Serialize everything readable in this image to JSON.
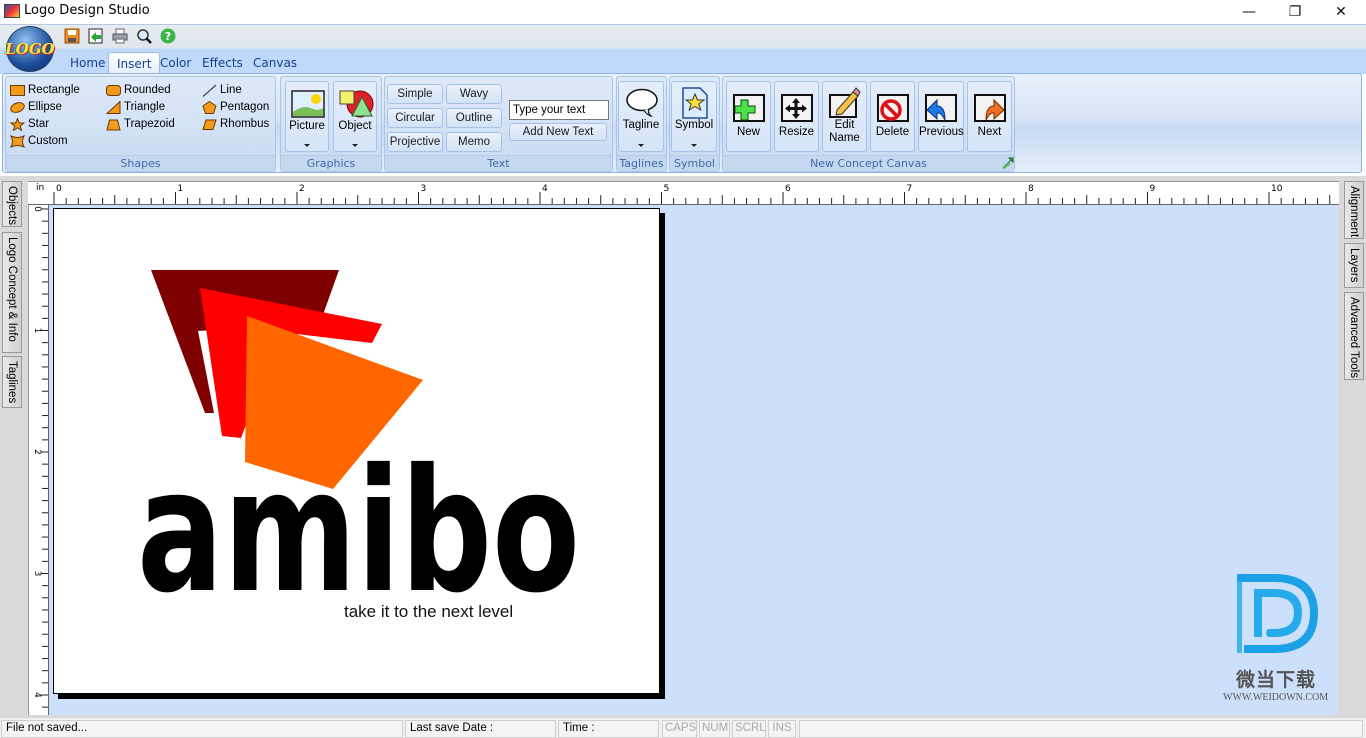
{
  "window": {
    "title": "Logo Design Studio",
    "controls": {
      "minimize": "—",
      "restore": "❐",
      "close": "✕"
    }
  },
  "app_orb": {
    "label": "LOGO"
  },
  "quick_access": [
    {
      "name": "save",
      "icon": "floppy-disk-icon"
    },
    {
      "name": "save-as",
      "icon": "save-as-icon"
    },
    {
      "name": "print",
      "icon": "printer-icon"
    },
    {
      "name": "print-preview",
      "icon": "magnifier-icon"
    },
    {
      "name": "help",
      "icon": "help-icon",
      "glyph": "?"
    }
  ],
  "tabs": [
    {
      "label": "Home",
      "active": false
    },
    {
      "label": "Insert",
      "active": true
    },
    {
      "label": "Color",
      "active": false
    },
    {
      "label": "Effects",
      "active": false
    },
    {
      "label": "Canvas",
      "active": false
    }
  ],
  "ribbon": {
    "shapes": {
      "label": "Shapes",
      "items": [
        {
          "label": "Rectangle",
          "icon": "rectangle-icon"
        },
        {
          "label": "Ellipse",
          "icon": "ellipse-icon"
        },
        {
          "label": "Star",
          "icon": "star-icon"
        },
        {
          "label": "Custom",
          "icon": "custom-shape-icon"
        },
        {
          "label": "Rounded",
          "icon": "rounded-rectangle-icon"
        },
        {
          "label": "Triangle",
          "icon": "triangle-icon"
        },
        {
          "label": "Trapezoid",
          "icon": "trapezoid-icon"
        },
        {
          "label": "Line",
          "icon": "line-icon"
        },
        {
          "label": "Pentagon",
          "icon": "pentagon-icon"
        },
        {
          "label": "Rhombus",
          "icon": "rhombus-icon"
        }
      ]
    },
    "graphics": {
      "label": "Graphics",
      "picture": "Picture",
      "object": "Object"
    },
    "text": {
      "label": "Text",
      "buttons": [
        "Simple",
        "Wavy",
        "Circular",
        "Outline",
        "Projective",
        "Memo"
      ],
      "input_placeholder": "Type your text",
      "add_button": "Add New Text"
    },
    "taglines": {
      "label": "Taglines",
      "button": "Tagline"
    },
    "symbol": {
      "label": "Symbol",
      "button": "Symbol"
    },
    "concept_canvas": {
      "label": "New Concept Canvas",
      "buttons": [
        {
          "label": "New",
          "icon": "plus-icon"
        },
        {
          "label": "Resize",
          "icon": "move-arrows-icon"
        },
        {
          "label": "Edit Name",
          "icon": "pencil-icon"
        },
        {
          "label": "Delete",
          "icon": "no-sign-icon"
        },
        {
          "label": "Previous",
          "icon": "arrow-back-icon"
        },
        {
          "label": "Next",
          "icon": "arrow-forward-icon"
        }
      ]
    }
  },
  "side_tabs_left": [
    "Objects",
    "Logo Concept & Info",
    "Taglines"
  ],
  "side_tabs_right": [
    "Alignment",
    "Layers",
    "Advanced Tools"
  ],
  "ruler": {
    "unit": "in",
    "h_labels": [
      "0",
      "1",
      "2",
      "3",
      "4",
      "5",
      "6",
      "7",
      "8",
      "9",
      "10"
    ],
    "v_labels": [
      "0",
      "1",
      "2",
      "3",
      "4"
    ]
  },
  "logo": {
    "wordmark": "amibo",
    "tagline": "take it to the next level",
    "colors": {
      "back": "#7f0000",
      "middle": "#ff0000",
      "front": "#ff6600",
      "text": "#000000"
    }
  },
  "watermark": {
    "brand": "微当下载",
    "url": "WWW.WEIDOWN.COM",
    "color": "#1da1e6"
  },
  "statusbar": {
    "file_status": "File not saved...",
    "last_save": "Last save Date :",
    "time": "Time :",
    "caps": "CAPS",
    "num": "NUM",
    "scrl": "SCRL",
    "ins": "INS"
  }
}
